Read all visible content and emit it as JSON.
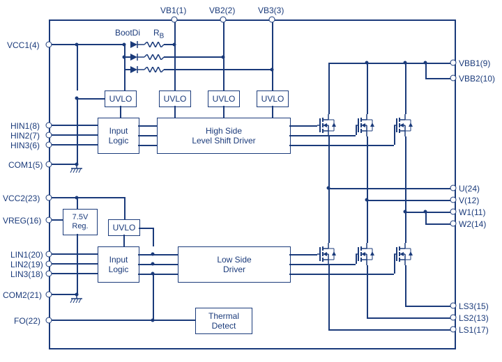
{
  "pins_top": {
    "vb1": "VB1(1)",
    "vb2": "VB2(2)",
    "vb3": "VB3(3)"
  },
  "pins_left": {
    "vcc1": "VCC1(4)",
    "hin1": "HIN1(8)",
    "hin2": "HIN2(7)",
    "hin3": "HIN3(6)",
    "com1": "COM1(5)",
    "vcc2": "VCC2(23)",
    "vreg": "VREG(16)",
    "lin1": "LIN1(20)",
    "lin2": "LIN2(19)",
    "lin3": "LIN3(18)",
    "com2": "COM2(21)",
    "fo": "FO(22)"
  },
  "pins_right": {
    "vbb1": "VBB1(9)",
    "vbb2": "VBB2(10)",
    "u": "U(24)",
    "v": "V(12)",
    "w1": "W1(11)",
    "w2": "W2(14)",
    "ls3": "LS3(15)",
    "ls2": "LS2(13)",
    "ls1": "LS1(17)"
  },
  "components": {
    "bootdi": "BootDi",
    "rb": "R",
    "rb_sub": "B"
  },
  "blocks": {
    "uvlo": "UVLO",
    "input_logic": "Input\nLogic",
    "hs_driver": "High Side\nLevel Shift Driver",
    "reg75": "7.5V\nReg.",
    "ls_driver": "Low Side\nDriver",
    "thermal": "Thermal\nDetect"
  }
}
